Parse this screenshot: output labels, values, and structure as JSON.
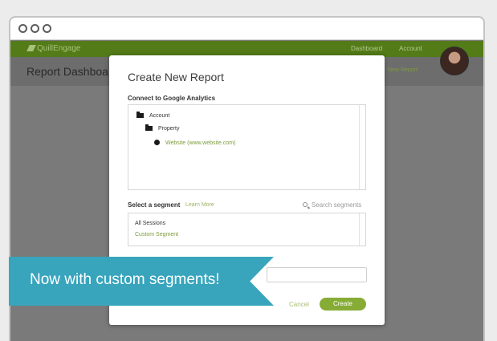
{
  "app": {
    "brand": "QuillEngage",
    "nav": [
      "Dashboard",
      "Account"
    ],
    "page_title": "Report Dashboard",
    "new_report_link": "New Report"
  },
  "modal": {
    "title": "Create New Report",
    "connect_label": "Connect to Google Analytics",
    "tree": [
      {
        "label": "Account",
        "icon": "folder-icon",
        "level": 0
      },
      {
        "label": "Property",
        "icon": "folder-icon",
        "level": 1
      },
      {
        "label": "Website (www.website.com)",
        "icon": "globe-icon",
        "level": 2
      }
    ],
    "segment_label": "Select a segment",
    "learn_more": "Learn More",
    "search_placeholder": "Search segments",
    "segments": [
      "All Sessions",
      "Custom Segment"
    ],
    "cancel_label": "Cancel",
    "create_label": "Create"
  },
  "banner": {
    "text": "Now with custom segments!"
  },
  "colors": {
    "brand_green": "#537b18",
    "accent_green": "#86ac35",
    "banner_blue": "#38a5bd"
  }
}
